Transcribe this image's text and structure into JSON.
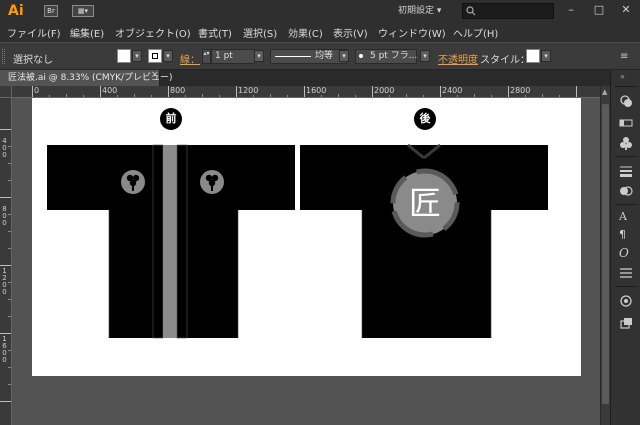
{
  "app": {
    "logo": "Ai"
  },
  "titlebar": {
    "bridge_label": "Br",
    "workspace": "初期設定 ▾",
    "search_placeholder": "",
    "minimize": "–",
    "maximize": "□",
    "close": "✕"
  },
  "menu": {
    "items": [
      "ファイル(F)",
      "編集(E)",
      "オブジェクト(O)",
      "書式(T)",
      "選択(S)",
      "効果(C)",
      "表示(V)",
      "ウィンドウ(W)",
      "ヘルプ(H)"
    ]
  },
  "control": {
    "selection": "選択なし",
    "stroke_label": "線：",
    "stroke_weight": "1 pt",
    "stroke_profile": "均等",
    "brush": "5 pt フラ...",
    "opacity_label": "不透明度",
    "style_label": "スタイル："
  },
  "document": {
    "tab_title": "匠法被.ai @ 8.33% (CMYK/プレビュー)",
    "tab_close": "×"
  },
  "ruler": {
    "top_labels": [
      "0",
      "400",
      "800",
      "1200",
      "1600",
      "2000",
      "2400",
      "2800"
    ],
    "left_labels": [
      "400",
      "800",
      "1200",
      "1600"
    ]
  },
  "artwork": {
    "front_label": "前",
    "back_label": "後",
    "back_kanji": "匠"
  },
  "colors": {
    "accent": "#ff9a00",
    "canvas": "#535353",
    "ui_dark": "#2f2f2f",
    "happi_body": "#000000",
    "collar_stripe": "#8c8c8c",
    "crest_gray": "#8a8a8a"
  },
  "panel": {
    "icons": [
      "color-icon",
      "color-guide-icon",
      "swatches-icon",
      "brushes-icon",
      "symbols-icon",
      "stroke-icon",
      "gradient-icon",
      "transparency-icon",
      "character-icon",
      "paragraph-icon",
      "opentype-icon",
      "align-icon",
      "layers-icon",
      "artboards-icon"
    ]
  }
}
